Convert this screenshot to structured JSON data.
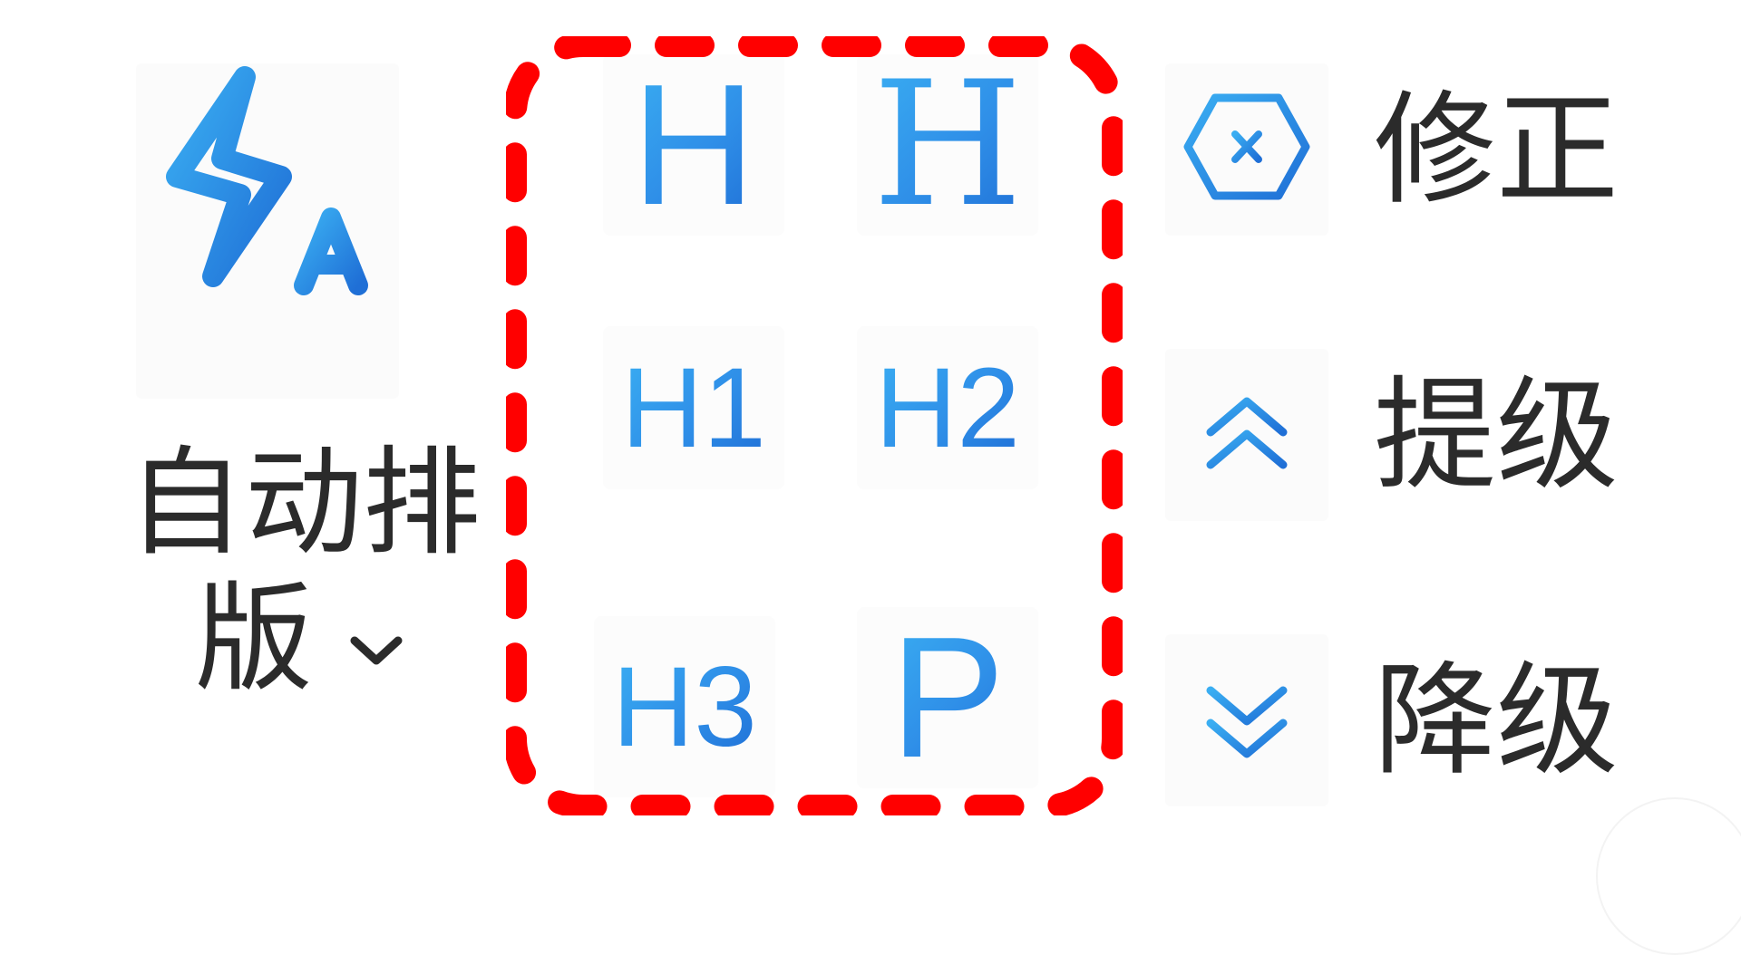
{
  "auto_format": {
    "label_line1": "自动排",
    "label_line2": "版"
  },
  "headings": {
    "h_plain": "H",
    "h_serif": "H",
    "h1": "H1",
    "h2": "H2",
    "h3": "H3",
    "p": "P"
  },
  "commands": {
    "fix_label": "修正",
    "promote_label": "提级",
    "demote_label": "降级"
  },
  "colors": {
    "icon_gradient_start": "#3aaef2",
    "icon_gradient_end": "#1f6fd6",
    "highlight": "#ff0000",
    "text": "#2b2b2b"
  }
}
